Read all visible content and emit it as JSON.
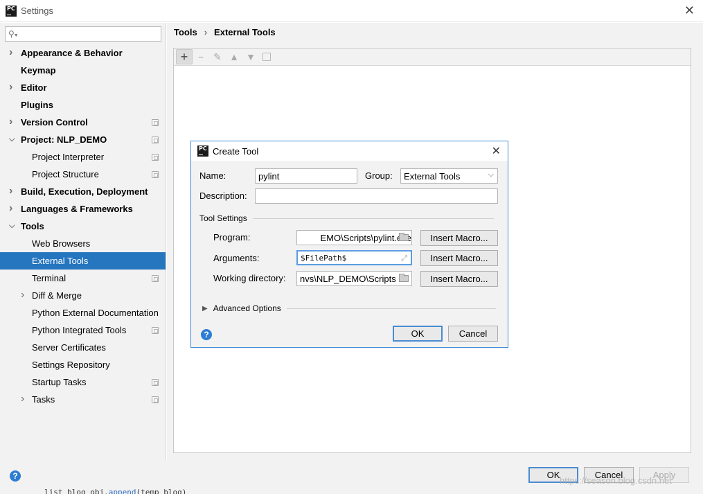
{
  "window": {
    "title": "Settings",
    "close_glyph": "✕"
  },
  "search": {
    "placeholder": "",
    "value": ""
  },
  "sidebar": {
    "items": [
      {
        "label": "Appearance & Behavior",
        "level": 0,
        "bold": true,
        "arrow": "right"
      },
      {
        "label": "Keymap",
        "level": 0,
        "bold": true
      },
      {
        "label": "Editor",
        "level": 0,
        "bold": true,
        "arrow": "right"
      },
      {
        "label": "Plugins",
        "level": 0,
        "bold": true
      },
      {
        "label": "Version Control",
        "level": 0,
        "bold": true,
        "arrow": "right",
        "project_icon": true
      },
      {
        "label": "Project: NLP_DEMO",
        "level": 0,
        "bold": true,
        "arrow": "down",
        "project_icon": true
      },
      {
        "label": "Project Interpreter",
        "level": 1,
        "project_icon": true
      },
      {
        "label": "Project Structure",
        "level": 1,
        "project_icon": true
      },
      {
        "label": "Build, Execution, Deployment",
        "level": 0,
        "bold": true,
        "arrow": "right"
      },
      {
        "label": "Languages & Frameworks",
        "level": 0,
        "bold": true,
        "arrow": "right"
      },
      {
        "label": "Tools",
        "level": 0,
        "bold": true,
        "arrow": "down"
      },
      {
        "label": "Web Browsers",
        "level": 1
      },
      {
        "label": "External Tools",
        "level": 1,
        "selected": true
      },
      {
        "label": "Terminal",
        "level": 1,
        "project_icon": true
      },
      {
        "label": "Diff & Merge",
        "level": 1,
        "arrow": "right"
      },
      {
        "label": "Python External Documentation",
        "level": 1
      },
      {
        "label": "Python Integrated Tools",
        "level": 1,
        "project_icon": true
      },
      {
        "label": "Server Certificates",
        "level": 1
      },
      {
        "label": "Settings Repository",
        "level": 1
      },
      {
        "label": "Startup Tasks",
        "level": 1,
        "project_icon": true
      },
      {
        "label": "Tasks",
        "level": 1,
        "arrow": "right",
        "project_icon": true
      }
    ]
  },
  "breadcrumb": {
    "parent": "Tools",
    "separator": "›",
    "current": "External Tools"
  },
  "toolbar": {
    "add": "+",
    "remove": "−",
    "edit": "✎",
    "up": "▲",
    "down": "▼"
  },
  "footer": {
    "help": "?",
    "ok": "OK",
    "cancel": "Cancel",
    "apply": "Apply"
  },
  "background_code": {
    "prefix": "list_blog_obj.",
    "fn": "append",
    "suffix": "(temp_blog)"
  },
  "watermark": "https://season.blog.csdn.net",
  "dialog": {
    "title": "Create Tool",
    "close_glyph": "✕",
    "name_label": "Name:",
    "name_value": "pylint",
    "group_label": "Group:",
    "group_value": "External Tools",
    "description_label": "Description:",
    "description_value": "",
    "tool_settings_label": "Tool Settings",
    "program_label": "Program:",
    "program_value": "EMO\\Scripts\\pylint.exe",
    "arguments_label": "Arguments:",
    "arguments_value": "$FilePath$",
    "working_dir_label": "Working directory:",
    "working_dir_value": "nvs\\NLP_DEMO\\Scripts",
    "insert_macro": "Insert Macro...",
    "advanced_label": "Advanced Options",
    "ok": "OK",
    "cancel": "Cancel",
    "help": "?"
  },
  "colors": {
    "selection": "#2675bf",
    "help": "#2c7dd3",
    "focus": "#5b9ce1"
  }
}
